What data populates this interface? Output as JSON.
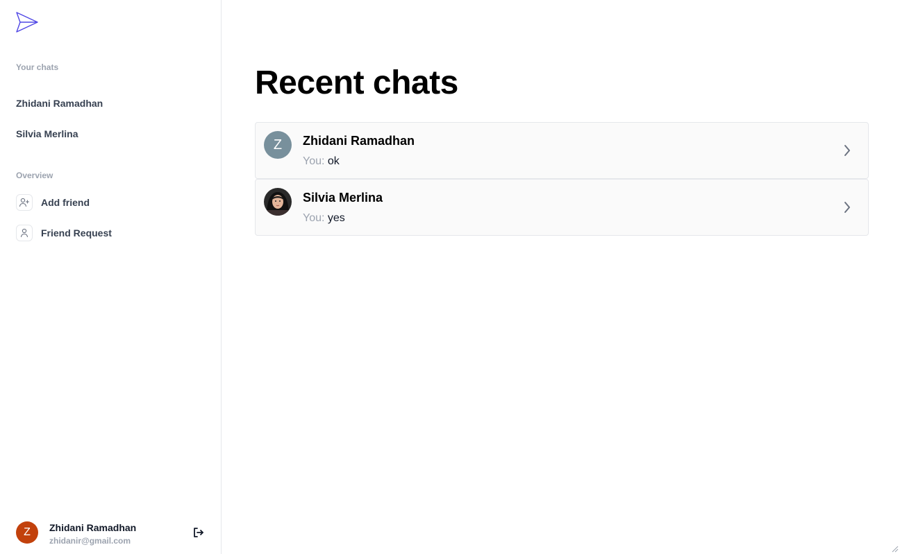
{
  "sidebar": {
    "chats_heading": "Your chats",
    "chats": [
      {
        "name": "Zhidani Ramadhan"
      },
      {
        "name": "Silvia Merlina"
      }
    ],
    "overview_heading": "Overview",
    "overview": [
      {
        "label": "Add friend",
        "icon": "user-plus-icon"
      },
      {
        "label": "Friend Request",
        "icon": "user-icon"
      }
    ],
    "profile": {
      "initial": "Z",
      "name": "Zhidani Ramadhan",
      "email": "zhidanir@gmail.com",
      "avatar_color": "#c2410c"
    }
  },
  "main": {
    "title": "Recent chats",
    "chats": [
      {
        "initial": "Z",
        "name": "Zhidani Ramadhan",
        "prefix": "You:",
        "message": "ok",
        "avatar_color": "#78909c"
      },
      {
        "initial": "",
        "name": "Silvia Merlina",
        "prefix": "You:",
        "message": "yes",
        "avatar": "photo"
      }
    ]
  },
  "colors": {
    "accent": "#4f46e5",
    "card_background": "#fafafa",
    "muted_text": "#9ca3af"
  }
}
